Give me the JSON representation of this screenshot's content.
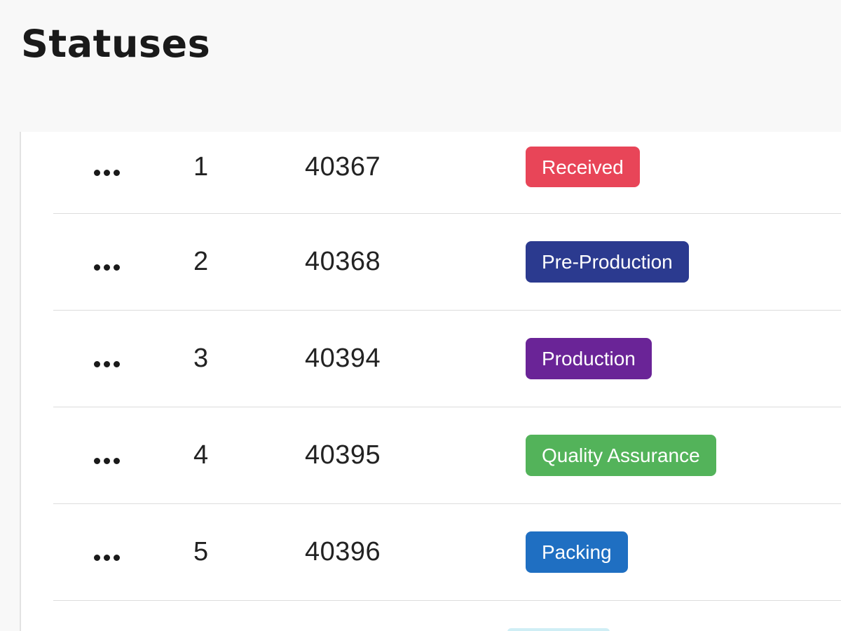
{
  "page": {
    "title": "Statuses"
  },
  "rows": [
    {
      "index": "1",
      "order": "40367",
      "status": "Received",
      "color": "#e84558"
    },
    {
      "index": "2",
      "order": "40368",
      "status": "Pre-Production",
      "color": "#2b3a8f"
    },
    {
      "index": "3",
      "order": "40394",
      "status": "Production",
      "color": "#6a2497"
    },
    {
      "index": "4",
      "order": "40395",
      "status": "Quality Assurance",
      "color": "#53b35a"
    },
    {
      "index": "5",
      "order": "40396",
      "status": "Packing",
      "color": "#1f6fc2"
    }
  ],
  "partial_next_badge_color": "#cfeef5"
}
